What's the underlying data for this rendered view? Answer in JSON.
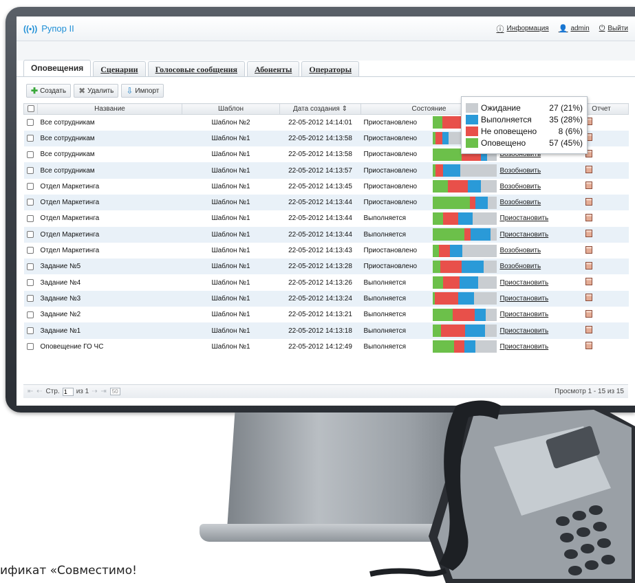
{
  "header": {
    "app_title": "Рупор II",
    "info_link": "Информация",
    "user": "admin",
    "logout": "Выйти"
  },
  "tabs": [
    "Оповещения",
    "Сценарии",
    "Голосовые сообщения",
    "Абоненты",
    "Операторы"
  ],
  "toolbar": {
    "create": "Создать",
    "delete": "Удалить",
    "import": "Импорт"
  },
  "table": {
    "columns": [
      "Название",
      "Шаблон",
      "Дата создания ⇕",
      "Состояние",
      "",
      "Отчет"
    ],
    "rows": [
      {
        "name": "Все сотрудникам",
        "template": "Шаблон №2",
        "date": "22-05-2012 14:14:01",
        "status": "Приостановлено",
        "action": "Возобновить",
        "bar": [
          0.15,
          0.35,
          0.05,
          0.45
        ]
      },
      {
        "name": "Все сотрудникам",
        "template": "Шаблон №1",
        "date": "22-05-2012 14:13:58",
        "status": "Приостановлено",
        "action": "Возобновить",
        "bar": [
          0.05,
          0.1,
          0.1,
          0.75
        ]
      },
      {
        "name": "Все сотрудникам",
        "template": "Шаблон №1",
        "date": "22-05-2012 14:13:58",
        "status": "Приостановлено",
        "action": "Возобновить",
        "bar": [
          0.45,
          0.3,
          0.1,
          0.15
        ]
      },
      {
        "name": "Все сотрудникам",
        "template": "Шаблон №1",
        "date": "22-05-2012 14:13:57",
        "status": "Приостановлено",
        "action": "Возобновить",
        "bar": [
          0.05,
          0.12,
          0.26,
          0.57
        ]
      },
      {
        "name": "Отдел Маркетинга",
        "template": "Шаблон №1",
        "date": "22-05-2012 14:13:45",
        "status": "Приостановлено",
        "action": "Возобновить",
        "bar": [
          0.24,
          0.31,
          0.2,
          0.25
        ]
      },
      {
        "name": "Отдел Маркетинга",
        "template": "Шаблон №1",
        "date": "22-05-2012 14:13:44",
        "status": "Приостановлено",
        "action": "Возобновить",
        "bar": [
          0.58,
          0.08,
          0.2,
          0.14
        ]
      },
      {
        "name": "Отдел Маркетинга",
        "template": "Шаблон №1",
        "date": "22-05-2012 14:13:44",
        "status": "Выполняется",
        "action": "Приостановить",
        "bar": [
          0.17,
          0.23,
          0.22,
          0.38
        ]
      },
      {
        "name": "Отдел Маркетинга",
        "template": "Шаблон №1",
        "date": "22-05-2012 14:13:44",
        "status": "Выполняется",
        "action": "Приостановить",
        "bar": [
          0.49,
          0.1,
          0.31,
          0.1
        ]
      },
      {
        "name": "Отдел Маркетинга",
        "template": "Шаблон №1",
        "date": "22-05-2012 14:13:43",
        "status": "Приостановлено",
        "action": "Возобновить",
        "bar": [
          0.1,
          0.17,
          0.19,
          0.54
        ]
      },
      {
        "name": "Задание №5",
        "template": "Шаблон №1",
        "date": "22-05-2012 14:13:28",
        "status": "Приостановлено",
        "action": "Возобновить",
        "bar": [
          0.12,
          0.33,
          0.34,
          0.21
        ]
      },
      {
        "name": "Задание №4",
        "template": "Шаблон №1",
        "date": "22-05-2012 14:13:26",
        "status": "Выполняется",
        "action": "Приостановить",
        "bar": [
          0.16,
          0.26,
          0.29,
          0.29
        ]
      },
      {
        "name": "Задание №3",
        "template": "Шаблон №1",
        "date": "22-05-2012 14:13:24",
        "status": "Выполняется",
        "action": "Приостановить",
        "bar": [
          0.04,
          0.36,
          0.24,
          0.36
        ]
      },
      {
        "name": "Задание №2",
        "template": "Шаблон №1",
        "date": "22-05-2012 14:13:21",
        "status": "Выполняется",
        "action": "Приостановить",
        "bar": [
          0.31,
          0.34,
          0.18,
          0.17
        ]
      },
      {
        "name": "Задание №1",
        "template": "Шаблон №1",
        "date": "22-05-2012 14:13:18",
        "status": "Выполняется",
        "action": "Приостановить",
        "bar": [
          0.13,
          0.38,
          0.3,
          0.19
        ]
      },
      {
        "name": "Оповещение ГО ЧС",
        "template": "Шаблон №1",
        "date": "22-05-2012 14:12:49",
        "status": "Выполняется",
        "action": "Приостановить",
        "bar": [
          0.33,
          0.16,
          0.18,
          0.33
        ]
      }
    ]
  },
  "legend": [
    {
      "name": "Ожидание",
      "value": "27 (21%)",
      "color": "#c9cdd1"
    },
    {
      "name": "Выполняется",
      "value": "35 (28%)",
      "color": "#2a9ad8"
    },
    {
      "name": "Не оповещено",
      "value": "8 (6%)",
      "color": "#e8504a"
    },
    {
      "name": "Оповещено",
      "value": "57 (45%)",
      "color": "#6cc04a"
    }
  ],
  "pager": {
    "page_label": "Стр.",
    "page": "1",
    "of": "из 1",
    "size": "50",
    "summary": "Просмотр 1 - 15 из 15"
  },
  "caption": "ификат «Совместимо!"
}
